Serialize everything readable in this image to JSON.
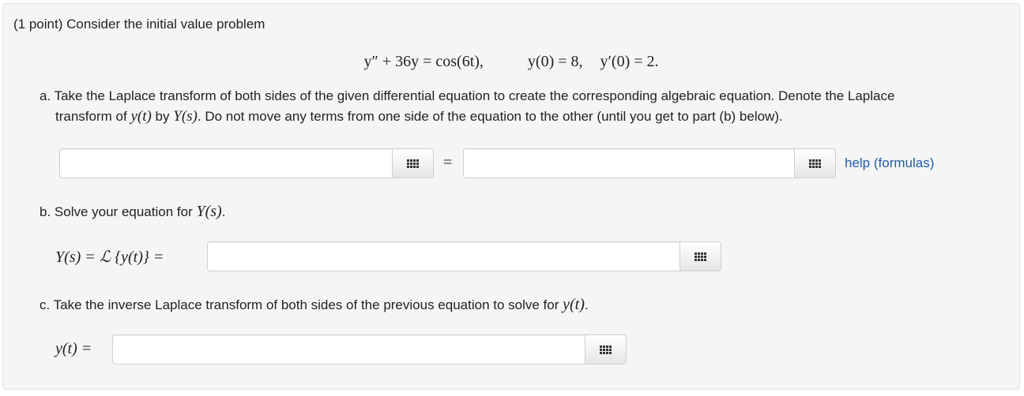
{
  "intro": "(1 point) Consider the initial value problem",
  "equation": {
    "lhs": "y″ + 36y = cos(6t),",
    "ic1": "y(0) = 8,",
    "ic2": "y′(0) = 2."
  },
  "part_a": {
    "line1": "a. Take the Laplace transform of both sides of the given differential equation to create the corresponding algebraic equation. Denote the Laplace",
    "line2_pre": "transform of",
    "line2_y": "y(t)",
    "line2_by": "by",
    "line2_Y": "Y(s)",
    "line2_post": ". Do not move any terms from one side of the equation to the other (until you get to part (b) below).",
    "equals": "=",
    "help_link": "help (formulas)"
  },
  "part_b": {
    "prompt_pre": "b. Solve your equation for",
    "prompt_Y": "Y(s)",
    "prompt_post": ".",
    "label": "Y(s) = ℒ {y(t)} ="
  },
  "part_c": {
    "prompt_pre": "c. Take the inverse Laplace transform of both sides of the previous equation to solve for",
    "prompt_y": "y(t)",
    "prompt_post": ".",
    "label": "y(t) ="
  },
  "icons": {
    "palette": "equation-palette-icon"
  },
  "colors": {
    "panel_bg": "#f5f5f5",
    "link": "#1f5ca8"
  }
}
